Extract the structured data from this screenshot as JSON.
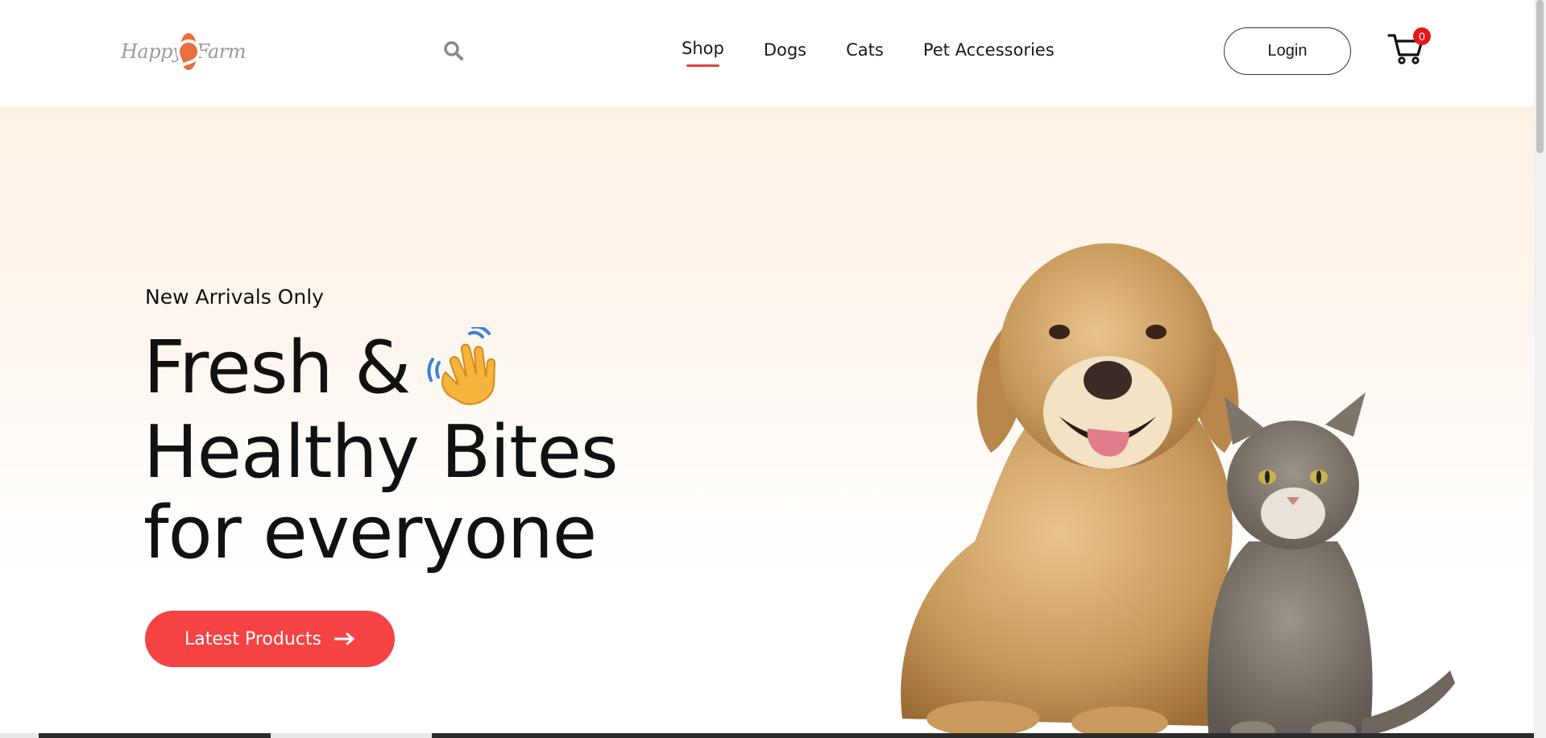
{
  "header": {
    "logo": {
      "left_text": "Happy",
      "right_text": "Farm"
    },
    "search_icon": "search-icon",
    "nav": [
      {
        "label": "Shop",
        "active": true
      },
      {
        "label": "Dogs",
        "active": false
      },
      {
        "label": "Cats",
        "active": false
      },
      {
        "label": "Pet Accessories",
        "active": false
      }
    ],
    "login_label": "Login",
    "cart": {
      "icon": "cart-icon",
      "count": "0"
    }
  },
  "hero": {
    "eyebrow": "New Arrivals Only",
    "headline": [
      "Fresh &",
      "Healthy Bites",
      "for everyone"
    ],
    "headline_emoji": "waving-hand-icon",
    "cta_label": "Latest Products",
    "cta_icon": "arrow-right-icon",
    "image": "dog-and-cat-illustration"
  },
  "colors": {
    "accent": "#f54343",
    "nav_underline": "#ef3e3e",
    "badge": "#e8161a",
    "logo_orange": "#e7703c",
    "hero_bg_top": "#fdf1e4"
  }
}
